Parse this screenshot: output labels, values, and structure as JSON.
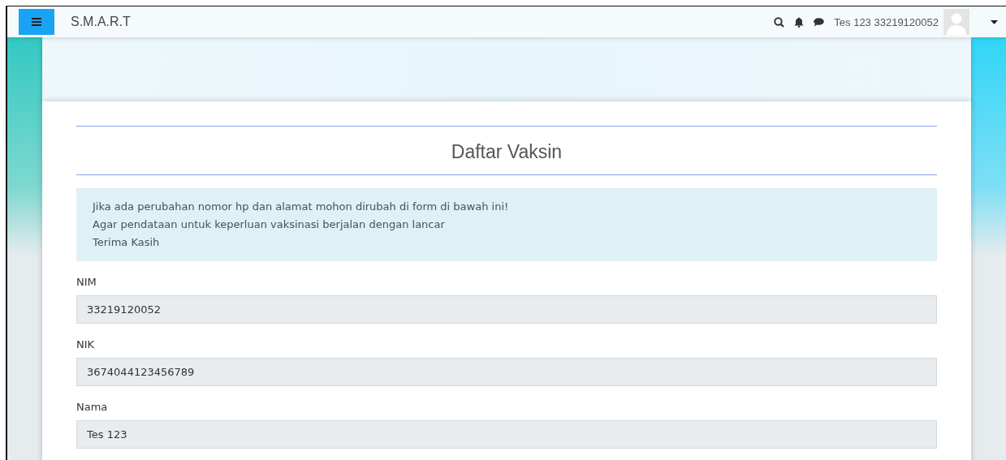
{
  "navbar": {
    "brand": "S.M.A.R.T",
    "user_name": "Tes 123 33219120052"
  },
  "page": {
    "title": "Daftar Vaksin",
    "alert": [
      "Jika ada perubahan nomor hp dan alamat mohon dirubah di form di bawah ini!",
      "Agar pendataan untuk keperluan vaksinasi berjalan dengan lancar",
      "Terima Kasih"
    ],
    "fields": [
      {
        "label": "NIM",
        "value": "33219120052",
        "disabled": true
      },
      {
        "label": "NIK",
        "value": "3674044123456789",
        "disabled": true
      },
      {
        "label": "Nama",
        "value": "Tes 123",
        "disabled": true
      }
    ]
  }
}
